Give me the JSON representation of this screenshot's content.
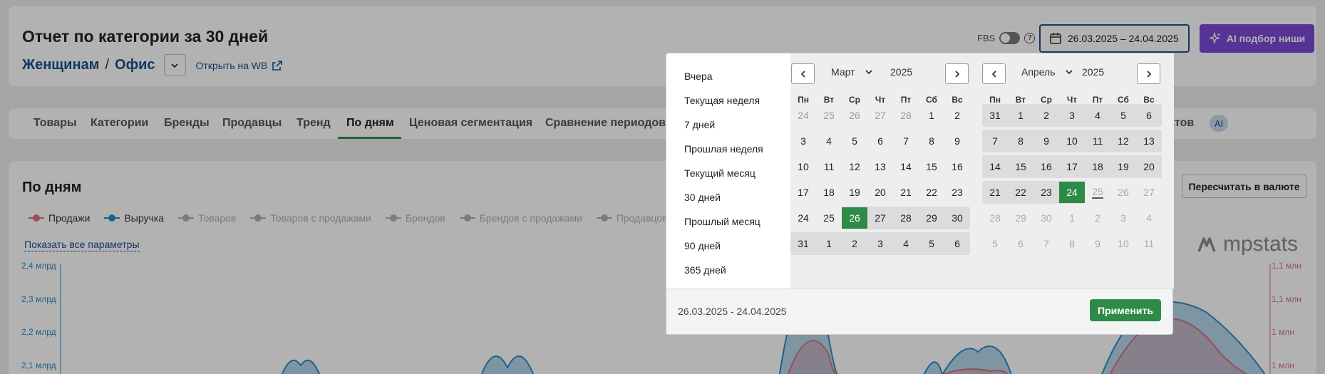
{
  "header": {
    "title": "Отчет по категории за 30 дней",
    "breadcrumb": [
      "Женщинам",
      "Офис"
    ],
    "open_wb": "Открыть на WB",
    "fbs_label": "FBS",
    "date_range": "26.03.2025 – 24.04.2025",
    "ai_button": "AI подбор ниши"
  },
  "tabs": [
    {
      "label": "Товары"
    },
    {
      "label": "Категории"
    },
    {
      "label": "Бренды"
    },
    {
      "label": "Продавцы"
    },
    {
      "label": "Тренд"
    },
    {
      "label": "По дням",
      "active": true
    },
    {
      "label": "Ценовая сегментация"
    },
    {
      "label": "Сравнение периодов"
    },
    {
      "label": "ктов"
    }
  ],
  "ai_badge": "AI",
  "chart_section": {
    "title": "По дням",
    "legend": [
      {
        "label": "Продажи",
        "on": true,
        "color": "#d9707c"
      },
      {
        "label": "Выручка",
        "on": true,
        "color": "#2b8cc4"
      },
      {
        "label": "Товаров",
        "on": false
      },
      {
        "label": "Товаров с продажами",
        "on": false
      },
      {
        "label": "Брендов",
        "on": false
      },
      {
        "label": "Брендов с продажами",
        "on": false
      },
      {
        "label": "Продавцов",
        "on": false
      }
    ],
    "show_all": "Показать все параметры",
    "recalc": "Пересчитать в валюте",
    "brand": "mpstats",
    "y_left_ticks": [
      "2,4 млрд",
      "2,3 млрд",
      "2,2 млрд",
      "2,1 млрд"
    ],
    "y_right_ticks": [
      "1,1 млн",
      "1,1 млн",
      "1 млн",
      "1 млн"
    ]
  },
  "picker": {
    "presets": [
      "Вчера",
      "Текущая неделя",
      "7 дней",
      "Прошлая неделя",
      "Текущий месяц",
      "30 дней",
      "Прошлый месяц",
      "90 дней",
      "365 дней"
    ],
    "weekdays": [
      "Пн",
      "Вт",
      "Ср",
      "Чт",
      "Пт",
      "Сб",
      "Вс"
    ],
    "left_month": "Март",
    "left_year": "2025",
    "right_month": "Апрель",
    "right_year": "2025",
    "left_days": [
      [
        "24",
        "25",
        "26",
        "27",
        "28",
        "1",
        "2"
      ],
      [
        "3",
        "4",
        "5",
        "6",
        "7",
        "8",
        "9"
      ],
      [
        "10",
        "11",
        "12",
        "13",
        "14",
        "15",
        "16"
      ],
      [
        "17",
        "18",
        "19",
        "20",
        "21",
        "22",
        "23"
      ],
      [
        "24",
        "25",
        "26",
        "27",
        "28",
        "29",
        "30"
      ],
      [
        "31",
        "1",
        "2",
        "3",
        "4",
        "5",
        "6"
      ]
    ],
    "right_days": [
      [
        "31",
        "1",
        "2",
        "3",
        "4",
        "5",
        "6"
      ],
      [
        "7",
        "8",
        "9",
        "10",
        "11",
        "12",
        "13"
      ],
      [
        "14",
        "15",
        "16",
        "17",
        "18",
        "19",
        "20"
      ],
      [
        "21",
        "22",
        "23",
        "24",
        "25",
        "26",
        "27"
      ],
      [
        "28",
        "29",
        "30",
        "1",
        "2",
        "3",
        "4"
      ],
      [
        "5",
        "6",
        "7",
        "8",
        "9",
        "10",
        "11"
      ]
    ],
    "footer_range": "26.03.2025 - 24.04.2025",
    "apply": "Применить"
  },
  "colors": {
    "primary": "#1a4f8f",
    "accent_green": "#2e8b47",
    "ai_purple": "#7b49d6",
    "sales": "#d9707c",
    "revenue": "#2b8cc4"
  }
}
